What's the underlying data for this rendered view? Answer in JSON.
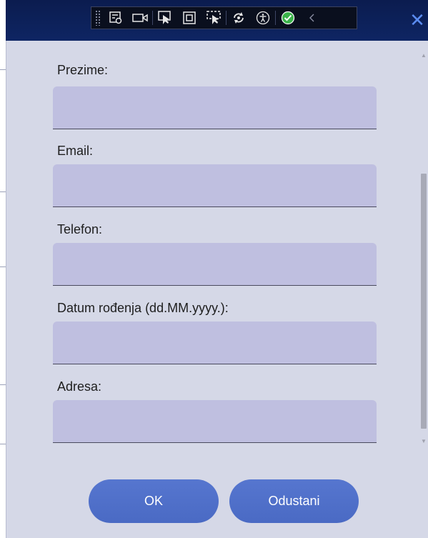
{
  "window": {
    "close_icon": "close-icon",
    "accent_color": "#0e2563"
  },
  "debug_toolbar": {
    "icons": [
      "live-visual-tree-icon",
      "record-icon",
      "select-element-icon",
      "display-layout-adorners-icon",
      "track-focus-icon",
      "hot-reload-icon",
      "accessibility-icon",
      "binding-check-icon",
      "collapse-chevron-icon"
    ]
  },
  "form": {
    "fields": [
      {
        "label": "Prezime:",
        "value": "",
        "placeholder": ""
      },
      {
        "label": "Email:",
        "value": "",
        "placeholder": ""
      },
      {
        "label": "Telefon:",
        "value": "",
        "placeholder": ""
      },
      {
        "label": "Datum rođenja (dd.MM.yyyy.):",
        "value": "",
        "placeholder": ""
      },
      {
        "label": "Adresa:",
        "value": "",
        "placeholder": ""
      }
    ],
    "input_color": "#bfbfe0",
    "background_color": "#d5d8e7"
  },
  "actions": {
    "ok_label": "OK",
    "cancel_label": "Odustani",
    "button_color": "#4f70ca"
  }
}
